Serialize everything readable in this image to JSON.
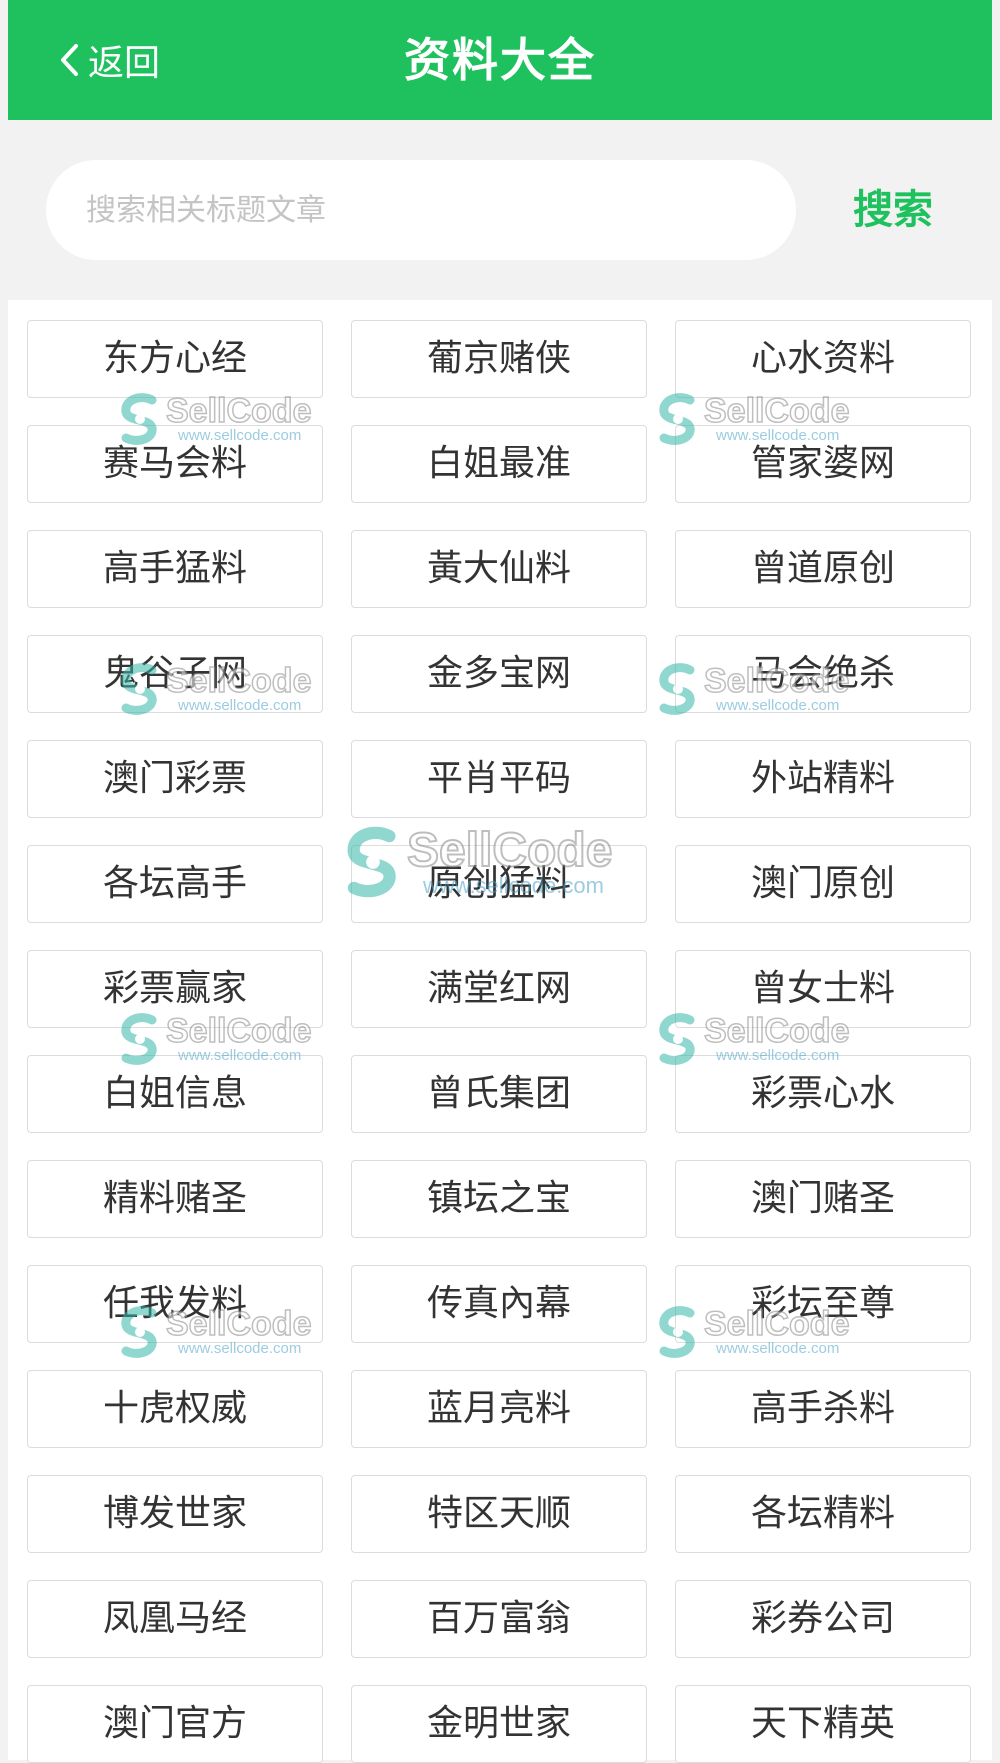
{
  "header": {
    "back_label": "返回",
    "title": "资料大全",
    "background_color": "#1fc15f"
  },
  "search": {
    "placeholder": "搜索相关标题文章",
    "button_label": "搜索"
  },
  "grid": {
    "items": [
      "东方心经",
      "葡京赌侠",
      "心水资料",
      "赛马会料",
      "白姐最准",
      "管家婆网",
      "高手猛料",
      "黃大仙料",
      "曾道原创",
      "鬼谷子网",
      "金多宝网",
      "马会绝杀",
      "澳门彩票",
      "平肖平码",
      "外站精料",
      "各坛高手",
      "原创猛料",
      "澳门原创",
      "彩票赢家",
      "满堂红网",
      "曾女士料",
      "白姐信息",
      "曾氏集团",
      "彩票心水",
      "精料赌圣",
      "镇坛之宝",
      "澳门赌圣",
      "任我发料",
      "传真內幕",
      "彩坛至尊",
      "十虎权威",
      "蓝月亮料",
      "高手杀料",
      "博发世家",
      "特区天顺",
      "各坛精料",
      "凤凰马经",
      "百万富翁",
      "彩券公司",
      "澳门官方",
      "金明世家",
      "天下精英"
    ]
  },
  "watermark": {
    "text": "SellCode",
    "url": "www.sellcode.com"
  }
}
